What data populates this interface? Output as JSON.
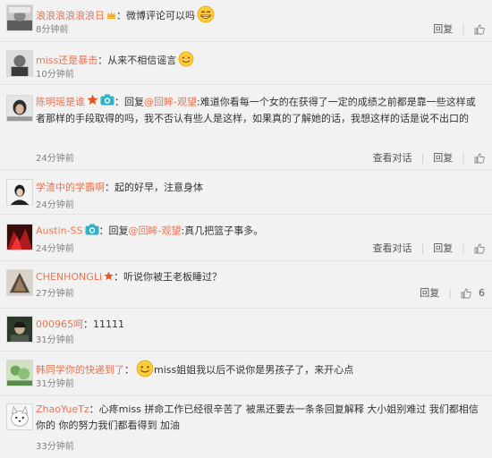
{
  "colors": {
    "name": "#eb7350",
    "text": "#333333",
    "time": "#808080",
    "bg": "#f2f2f2",
    "divider": "#e3e3e3"
  },
  "actions": {
    "reply": "回复",
    "view_conversation": "查看对话",
    "like_count_6": "6"
  },
  "comments": [
    {
      "name": "浪浪浪浪浪浪日",
      "colon": "：",
      "text": "微博评论可以吗",
      "time": "8分钟前",
      "emoji": "grin-emoji",
      "badge": "vip-crown-icon"
    },
    {
      "name": "miss还是暴击",
      "colon": "：",
      "text": "从来不相信谣言",
      "time": "10分钟前",
      "emoji": "smile-emoji"
    },
    {
      "name": "陈明瑶是谁",
      "colon": "：",
      "reply_prefix": "回复",
      "reply_target": "@回眸-观望",
      "text": "难道你看每一个女的在获得了一定的成绩之前都是靠一些这样或者那样的手段取得的吗，我不否认有些人是这样，如果真的了解她的话，我想这样的话是说不出口的",
      "time": "24分钟前"
    },
    {
      "name": "学渣中的学霸啊",
      "colon": "：",
      "text": "起的好早，注意身体",
      "time": "24分钟前"
    },
    {
      "name": "Austin-SS",
      "colon": "：",
      "reply_prefix": "回复",
      "reply_target": "@回眸-观望",
      "text": "真几把篮子事多。",
      "time": "24分钟前"
    },
    {
      "name": "CHENHONGLi",
      "colon": "：",
      "text": "听说你被王老板睡过？",
      "time": "27分钟前"
    },
    {
      "name": "000965呵",
      "colon": "：",
      "text": "11111",
      "time": "31分钟前"
    },
    {
      "name": "韩同学你的快递到了",
      "colon": "：",
      "text": "miss姐姐我以后不说你是男孩子了，来开心点",
      "time": "31分钟前"
    },
    {
      "name": "ZhaoYueTz",
      "colon": "：",
      "text": "心疼miss  拼命工作已经很辛苦了 被黑还要去一条条回复解释  大小姐别难过 我们都相信你的  你的努力我们都看得到  加油",
      "time": "33分钟前"
    }
  ]
}
